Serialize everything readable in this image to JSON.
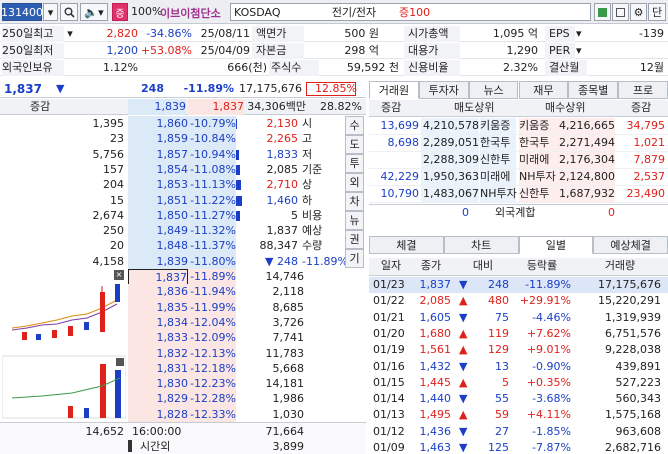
{
  "toolbar": {
    "code": "131400",
    "zoom": "100%",
    "name": "이브이첨단소",
    "market": "KOSDAQ",
    "sector": "전기/전자",
    "margin": "증100",
    "btn_reset": "단"
  },
  "info": {
    "r1": {
      "l": "250일최고",
      "v": "2,820",
      "p": "-34.86%",
      "d": "25/08/11",
      "l2": "액면가",
      "v2": "500 원",
      "l3": "시가총액",
      "v3": "1,095 억",
      "l4": "EPS",
      "v4": "-139"
    },
    "r2": {
      "l": "250일최저",
      "v": "1,200",
      "p": "+53.08%",
      "d": "25/04/09",
      "l2": "자본금",
      "v2": "298 억",
      "l3": "대용가",
      "v3": "1,290",
      "l4": "PER",
      "v4": ""
    },
    "r3": {
      "l": "외국인보유",
      "v": "1.12%",
      "v1b": "666(천)",
      "l2": "주식수",
      "v2": "59,592 천",
      "l3": "신용비율",
      "v3": "2.32%",
      "l4": "결산월",
      "v4": "12월"
    }
  },
  "quote": {
    "price": "1,837",
    "arrow": "▼",
    "change": "248",
    "rate": "-11.89%",
    "volume": "17,175,676",
    "vol_rate": "12.85%"
  },
  "ob_header": {
    "l": "증감",
    "a": "1,839",
    "b": "1,837",
    "c": "34,306백만",
    "d": "28.82%"
  },
  "asks": [
    {
      "qty": "1,395",
      "price": "1,860",
      "rate": "-10.79%"
    },
    {
      "qty": "23",
      "price": "1,859",
      "rate": "-10.84%"
    },
    {
      "qty": "5,756",
      "price": "1,857",
      "rate": "-10.94%"
    },
    {
      "qty": "157",
      "price": "1,854",
      "rate": "-11.08%"
    },
    {
      "qty": "204",
      "price": "1,853",
      "rate": "-11.13%"
    },
    {
      "qty": "15",
      "price": "1,851",
      "rate": "-11.22%"
    },
    {
      "qty": "2,674",
      "price": "1,850",
      "rate": "-11.27%"
    },
    {
      "qty": "250",
      "price": "1,849",
      "rate": "-11.32%"
    },
    {
      "qty": "20",
      "price": "1,848",
      "rate": "-11.37%"
    },
    {
      "qty": "4,158",
      "price": "1,839",
      "rate": "-11.80%"
    }
  ],
  "bids": [
    {
      "price": "1,837",
      "rate": "-11.89%",
      "qty": "14,746"
    },
    {
      "price": "1,836",
      "rate": "-11.94%",
      "qty": "2,118"
    },
    {
      "price": "1,835",
      "rate": "-11.99%",
      "qty": "8,685"
    },
    {
      "price": "1,834",
      "rate": "-12.04%",
      "qty": "3,726"
    },
    {
      "price": "1,833",
      "rate": "-12.09%",
      "qty": "7,741"
    },
    {
      "price": "1,832",
      "rate": "-12.13%",
      "qty": "11,783"
    },
    {
      "price": "1,831",
      "rate": "-12.18%",
      "qty": "5,668"
    },
    {
      "price": "1,830",
      "rate": "-12.23%",
      "qty": "14,181"
    },
    {
      "price": "1,829",
      "rate": "-12.28%",
      "qty": "1,986"
    },
    {
      "price": "1,828",
      "rate": "-12.33%",
      "qty": "1,030"
    }
  ],
  "side_info": [
    {
      "v": "2,130",
      "l": "시",
      "c": "red"
    },
    {
      "v": "2,265",
      "l": "고",
      "c": "red"
    },
    {
      "v": "1,833",
      "l": "저",
      "c": "blue"
    },
    {
      "v": "2,085",
      "l": "기준",
      "c": "blk"
    },
    {
      "v": "2,710",
      "l": "상",
      "c": "red"
    },
    {
      "v": "1,460",
      "l": "하",
      "c": "blue"
    },
    {
      "v": "5",
      "l": "비용",
      "c": "blk"
    },
    {
      "v": "1,837",
      "l": "예상",
      "c": "blk"
    },
    {
      "v": "88,347",
      "l": "수량",
      "c": "blk"
    },
    {
      "v": "248",
      "l": "-11.89%",
      "c": "blue",
      "arrow": "▼"
    }
  ],
  "vtabs": [
    "수",
    "도",
    "투",
    "외",
    "차",
    "뉴",
    "권",
    "기"
  ],
  "ob_footer": {
    "ask_total": "14,652",
    "time": "16:00:00",
    "bid_total": "71,664",
    "label2": "시간외",
    "v2": "3,899"
  },
  "broker_tabs": [
    "거래원",
    "투자자",
    "뉴스",
    "재무",
    "종목별",
    "프로"
  ],
  "broker_header": {
    "l": "증감",
    "sell": "매도상위",
    "buy": "매수상위",
    "r": "증감"
  },
  "brokers": [
    {
      "dl": "13,699",
      "sq": "4,210,578",
      "sn": "키움증",
      "bn": "키움증",
      "bq": "4,216,665",
      "dr": "34,795"
    },
    {
      "dl": "8,698",
      "sq": "2,289,051",
      "sn": "한국투",
      "bn": "한국투",
      "bq": "2,271,494",
      "dr": "1,021"
    },
    {
      "dl": "",
      "sq": "2,288,309",
      "sn": "신한투",
      "bn": "미래에",
      "bq": "2,176,304",
      "dr": "7,879"
    },
    {
      "dl": "42,229",
      "sq": "1,950,363",
      "sn": "미래에",
      "bn": "NH투자",
      "bq": "2,124,800",
      "dr": "2,537"
    },
    {
      "dl": "10,790",
      "sq": "1,483,067",
      "sn": "NH투자",
      "bn": "신한투",
      "bq": "1,687,932",
      "dr": "23,490"
    }
  ],
  "foreign": {
    "l": "0",
    "label": "외국계합",
    "r": "0"
  },
  "sub_tabs": [
    "체결",
    "차트",
    "일별",
    "예상체결"
  ],
  "daily_header": [
    "일자",
    "종가",
    "대비",
    "등락률",
    "거래량"
  ],
  "daily": [
    {
      "d": "01/23",
      "p": "1,837",
      "c": "blue",
      "a": "▼",
      "ch": "248",
      "r": "-11.89%",
      "v": "17,175,676",
      "sel": true
    },
    {
      "d": "01/22",
      "p": "2,085",
      "c": "red",
      "a": "▲",
      "ch": "480",
      "r": "+29.91%",
      "v": "15,220,291"
    },
    {
      "d": "01/21",
      "p": "1,605",
      "c": "blue",
      "a": "▼",
      "ch": "75",
      "r": "-4.46%",
      "v": "1,319,939"
    },
    {
      "d": "01/20",
      "p": "1,680",
      "c": "red",
      "a": "▲",
      "ch": "119",
      "r": "+7.62%",
      "v": "6,751,576"
    },
    {
      "d": "01/19",
      "p": "1,561",
      "c": "red",
      "a": "▲",
      "ch": "129",
      "r": "+9.01%",
      "v": "9,228,038"
    },
    {
      "d": "01/16",
      "p": "1,432",
      "c": "blue",
      "a": "▼",
      "ch": "13",
      "r": "-0.90%",
      "v": "439,891"
    },
    {
      "d": "01/15",
      "p": "1,445",
      "c": "red",
      "a": "▲",
      "ch": "5",
      "r": "+0.35%",
      "v": "527,223"
    },
    {
      "d": "01/14",
      "p": "1,440",
      "c": "blue",
      "a": "▼",
      "ch": "55",
      "r": "-3.68%",
      "v": "560,343"
    },
    {
      "d": "01/13",
      "p": "1,495",
      "c": "red",
      "a": "▲",
      "ch": "59",
      "r": "+4.11%",
      "v": "1,575,168"
    },
    {
      "d": "01/12",
      "p": "1,436",
      "c": "blue",
      "a": "▼",
      "ch": "27",
      "r": "-1.85%",
      "v": "963,608"
    },
    {
      "d": "01/09",
      "p": "1,463",
      "c": "blue",
      "a": "▼",
      "ch": "125",
      "r": "-7.87%",
      "v": "2,682,716"
    }
  ],
  "colors": {
    "up": "#e0201b",
    "down": "#1a3fc6",
    "ask_bg": "#dce9f6",
    "bid_bg": "#fbe6e4"
  }
}
